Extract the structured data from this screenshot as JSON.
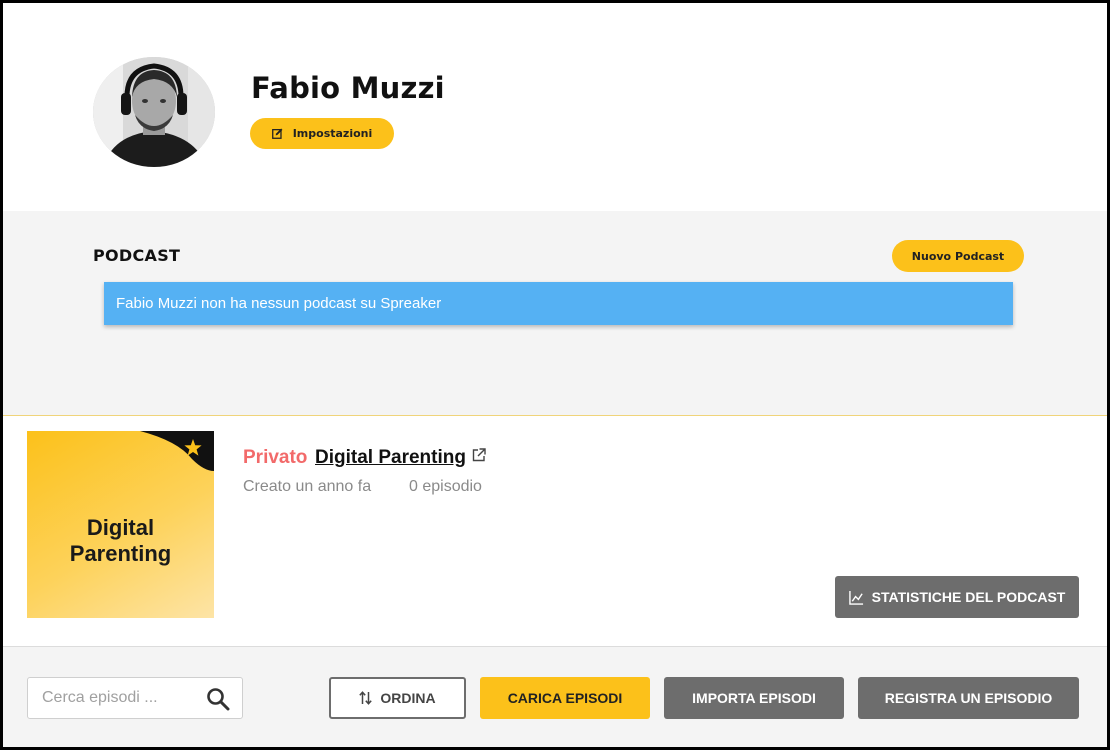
{
  "profile": {
    "name": "Fabio Muzzi",
    "settings_label": "Impostazioni"
  },
  "podcast_section": {
    "title": "PODCAST",
    "new_podcast_label": "Nuovo Podcast",
    "info_message": "Fabio Muzzi non ha nessun podcast su Spreaker"
  },
  "podcast_card": {
    "cover_title_line1": "Digital",
    "cover_title_line2": "Parenting",
    "status": "Privato",
    "name": "Digital Parenting",
    "created": "Creato un anno fa",
    "episodes": "0 episodio",
    "stats_label": "STATISTICHE DEL PODCAST"
  },
  "toolbar": {
    "search_placeholder": "Cerca episodi ...",
    "sort_label": "ORDINA",
    "upload_label": "CARICA EPISODI",
    "import_label": "IMPORTA EPISODI",
    "record_label": "REGISTRA UN EPISODIO"
  },
  "colors": {
    "accent": "#fcc11a",
    "info": "#55b1f3",
    "private": "#f26a6a",
    "dark_button": "#6d6d6d"
  },
  "icons": {
    "settings": "edit-icon",
    "external": "external-link-icon",
    "stats": "chart-icon",
    "search": "search-icon",
    "sort": "sort-icon",
    "cover_badge": "star-icon"
  }
}
